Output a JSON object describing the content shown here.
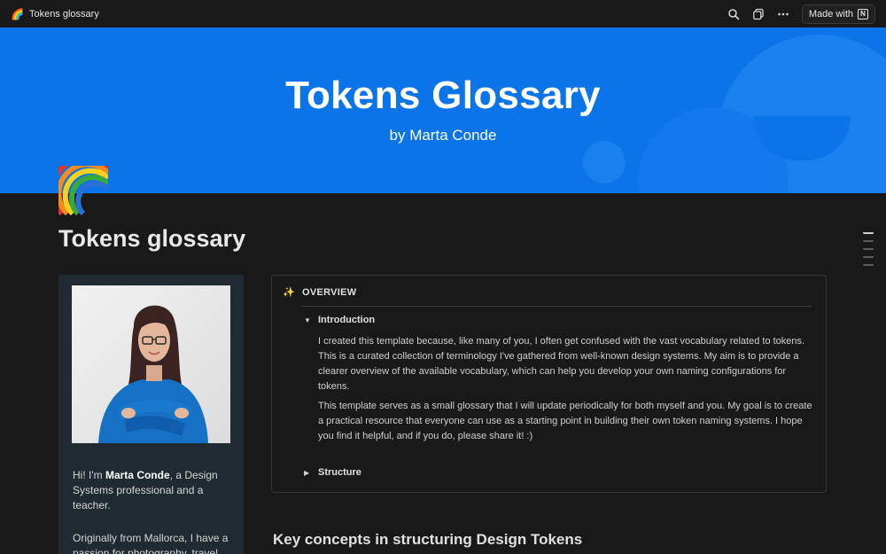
{
  "topbar": {
    "page_emoji": "🌈",
    "page_name": "Tokens glossary",
    "made_with_label": "Made with",
    "made_with_logo": "N",
    "icons": [
      "search-icon",
      "duplicate-icon",
      "more-icon"
    ]
  },
  "cover": {
    "title": "Tokens Glossary",
    "subtitle": "by Marta Conde",
    "color": "#0a74e8"
  },
  "page": {
    "icon": "rainbow-icon",
    "title": "Tokens glossary"
  },
  "profile": {
    "photo": "portrait-photo",
    "bio_greeting": "Hi! I'm ",
    "bio_name": "Marta Conde",
    "bio_rest": ", a Design Systems professional and a teacher.",
    "bio_second": "Originally from Mallorca, I have a passion for photography, travel"
  },
  "overview": {
    "emoji": "✨",
    "heading": "OVERVIEW",
    "toggles": [
      {
        "label": "Introduction",
        "expanded": true
      },
      {
        "label": "Structure",
        "expanded": false
      }
    ],
    "paragraphs": [
      "I created this template because, like many of you, I often get confused with the vast vocabulary related to tokens. This is a curated collection of terminology I've gathered from well-known design systems. My aim is to provide a clearer overview of the available vocabulary, which can help you develop your own naming configurations for tokens.",
      "This template serves as a small glossary that I will update periodically for both myself and you. My goal is to create a practical resource that everyone can use as a starting point in building their own token naming systems. I hope you find it helpful, and if you do, please share it! :)"
    ]
  },
  "section": {
    "heading": "Key concepts in structuring Design Tokens"
  }
}
